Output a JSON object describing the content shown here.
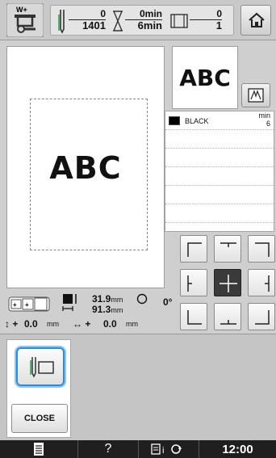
{
  "status": {
    "stitch_done": "0",
    "stitch_total": "1401",
    "time_done": "0min",
    "time_total": "6min",
    "color_done": "0",
    "color_total": "1"
  },
  "design": {
    "text": "ABC"
  },
  "colors": {
    "min_label": "min",
    "items": [
      {
        "name": "BLACK",
        "minutes": "6",
        "swatch": "#000000"
      }
    ]
  },
  "info": {
    "width_val": "31.9",
    "width_unit": "mm",
    "height_val": "91.3",
    "height_unit": "mm",
    "angle": "0°",
    "offset_v_val": "0.0",
    "offset_v_unit": "mm",
    "offset_h_val": "0.0",
    "offset_h_unit": "mm"
  },
  "lower": {
    "close_label": "CLOSE"
  },
  "bottombar": {
    "help": "?",
    "time": "12:00"
  },
  "accent": "#2b8cd8"
}
